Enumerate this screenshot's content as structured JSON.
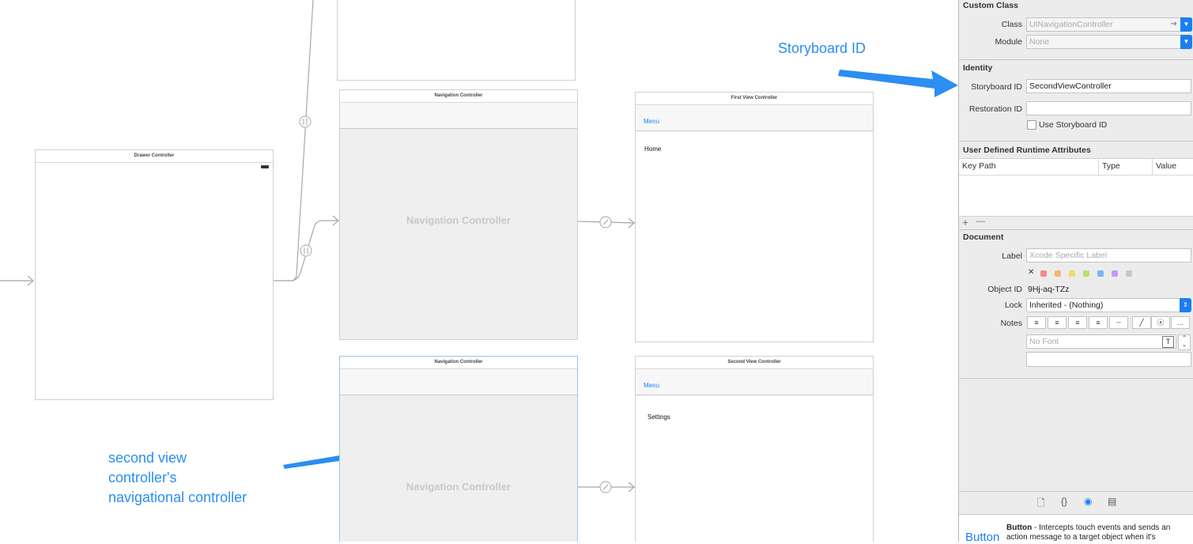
{
  "canvas": {
    "drawer_controller": {
      "title": "Drawer Controller"
    },
    "nav_controller_top": {
      "title": "Navigation Controller",
      "label": "Navigation Controller"
    },
    "nav_controller_bottom": {
      "title": "Navigation Controller",
      "label": "Navigation Controller"
    },
    "first_vc": {
      "title": "First View Controller",
      "menu": "Menu",
      "cell": "Home"
    },
    "second_vc": {
      "title": "Second View Controller",
      "menu": "Menu",
      "cell": "Settings"
    },
    "annotations": {
      "storyboard_id": "Storyboard ID",
      "second_nav_line1": "second view",
      "second_nav_line2": "controller's",
      "second_nav_line3": "navigational controller"
    },
    "annotation_color": "#2b8ef0"
  },
  "inspector": {
    "custom_class": {
      "title": "Custom Class",
      "class_label": "Class",
      "class_value": "UINavigationController",
      "module_label": "Module",
      "module_value": "None"
    },
    "identity": {
      "title": "Identity",
      "storyboard_id_label": "Storyboard ID",
      "storyboard_id_value": "SecondViewController",
      "restoration_id_label": "Restoration ID",
      "restoration_id_value": "",
      "use_storyboard_id_label": "Use Storyboard ID"
    },
    "runtime_attributes": {
      "title": "User Defined Runtime Attributes",
      "columns": [
        "Key Path",
        "Type",
        "Value"
      ],
      "add": "+",
      "remove": "—"
    },
    "document": {
      "title": "Document",
      "label_label": "Label",
      "label_placeholder": "Xcode Specific Label",
      "label_clear": "✕",
      "label_colors": [
        "#f08c8c",
        "#f5b56a",
        "#f2dc6a",
        "#b9e06a",
        "#7fb2f0",
        "#c69af0",
        "#c8c8c8"
      ],
      "object_id_label": "Object ID",
      "object_id_value": "9Hj-aq-TZz",
      "lock_label": "Lock",
      "lock_value": "Inherited - (Nothing)",
      "notes_label": "Notes",
      "font_placeholder": "No Font"
    },
    "library": {
      "title": "Button",
      "description": "Intercepts touch events and sends an action message to a target object when it's",
      "preview": "Button"
    },
    "accent_color": "#1a7ff0"
  }
}
